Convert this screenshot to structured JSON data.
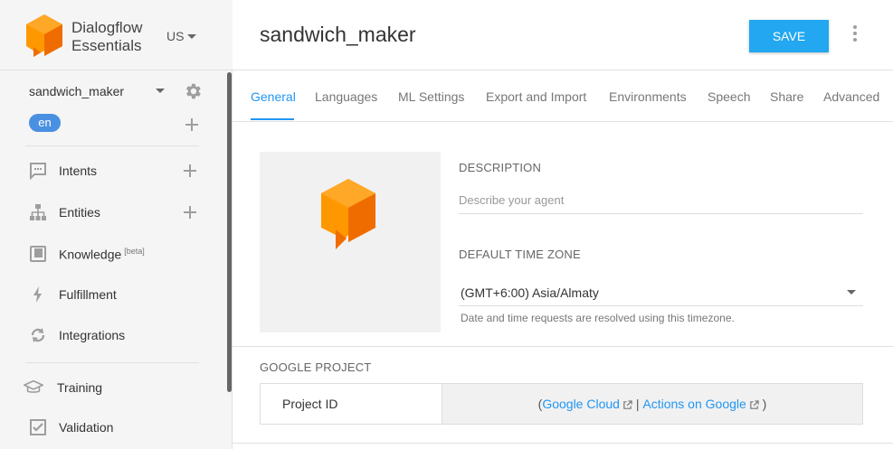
{
  "brand": {
    "name_line1": "Dialogflow",
    "name_line2": "Essentials",
    "region": "US"
  },
  "agent": {
    "name": "sandwich_maker",
    "language": "en"
  },
  "sidebar": {
    "items": [
      {
        "label": "Intents",
        "icon": "chat-bubble-icon"
      },
      {
        "label": "Entities",
        "icon": "hierarchy-icon"
      },
      {
        "label": "Knowledge",
        "sup": "[beta]",
        "icon": "book-icon"
      },
      {
        "label": "Fulfillment",
        "icon": "bolt-icon"
      },
      {
        "label": "Integrations",
        "icon": "sync-icon"
      },
      {
        "label": "Training",
        "icon": "graduation-cap-icon"
      },
      {
        "label": "Validation",
        "icon": "checkbox-icon"
      }
    ]
  },
  "header": {
    "title": "sandwich_maker",
    "save_label": "SAVE"
  },
  "tabs": [
    {
      "label": "General"
    },
    {
      "label": "Languages"
    },
    {
      "label": "ML Settings"
    },
    {
      "label": "Export and Import"
    },
    {
      "label": "Environments"
    },
    {
      "label": "Speech"
    },
    {
      "label": "Share"
    },
    {
      "label": "Advanced"
    }
  ],
  "general": {
    "description_label": "DESCRIPTION",
    "description_placeholder": "Describe your agent",
    "description_value": "",
    "timezone_label": "DEFAULT TIME ZONE",
    "timezone_value": "(GMT+6:00) Asia/Almaty",
    "timezone_hint": "Date and time requests are resolved using this timezone.",
    "google_project_label": "GOOGLE PROJECT",
    "project_id_label": "Project ID",
    "link_open": "(",
    "link_google_cloud": "Google Cloud",
    "link_separator": " | ",
    "link_actions_on_google": "Actions on Google",
    "link_close": " )"
  },
  "colors": {
    "accent": "#2196f3",
    "save_button": "#22a7f0",
    "logo_orange": "#ff9800",
    "language_chip": "#4a90e2"
  }
}
